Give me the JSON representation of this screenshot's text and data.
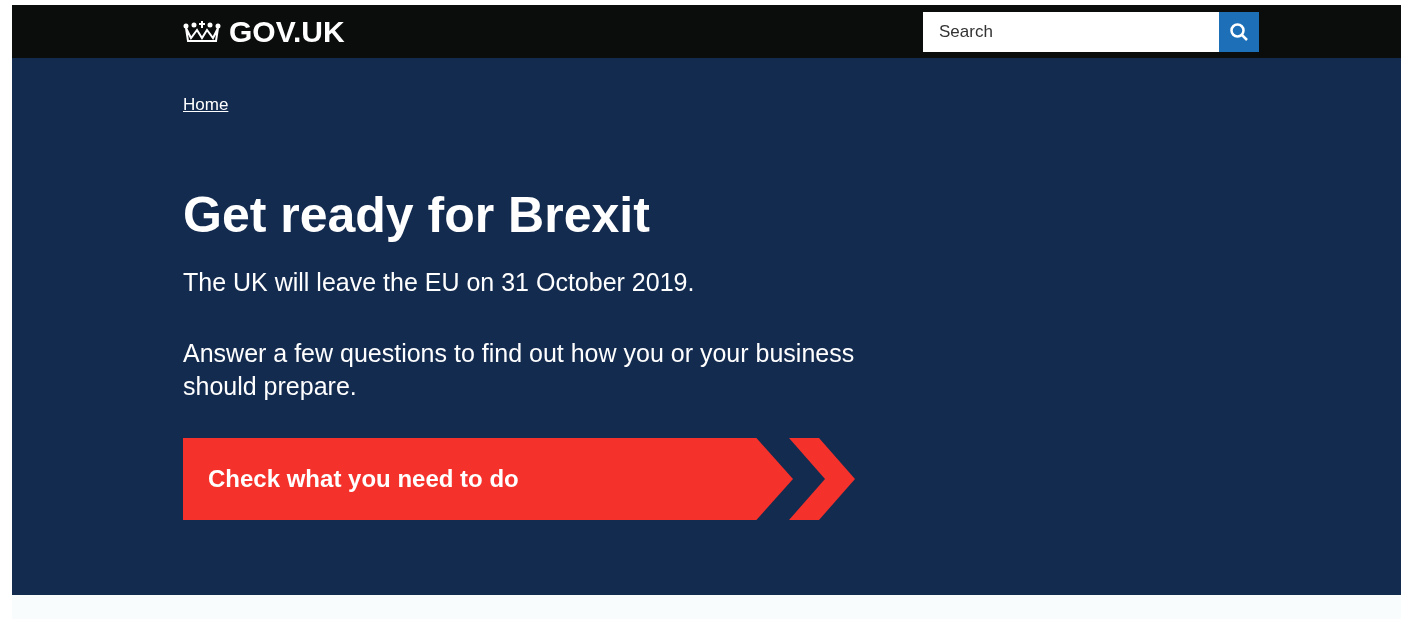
{
  "header": {
    "logo": "GOV.UK",
    "search": {
      "placeholder": "Search"
    }
  },
  "breadcrumbs": [
    "Home"
  ],
  "hero": {
    "title": "Get ready for Brexit",
    "paragraphs": [
      "The UK will leave the EU on 31 October 2019.",
      "Answer a few questions to find out how you or your business should prepare."
    ],
    "button": "Check what you need to do"
  }
}
